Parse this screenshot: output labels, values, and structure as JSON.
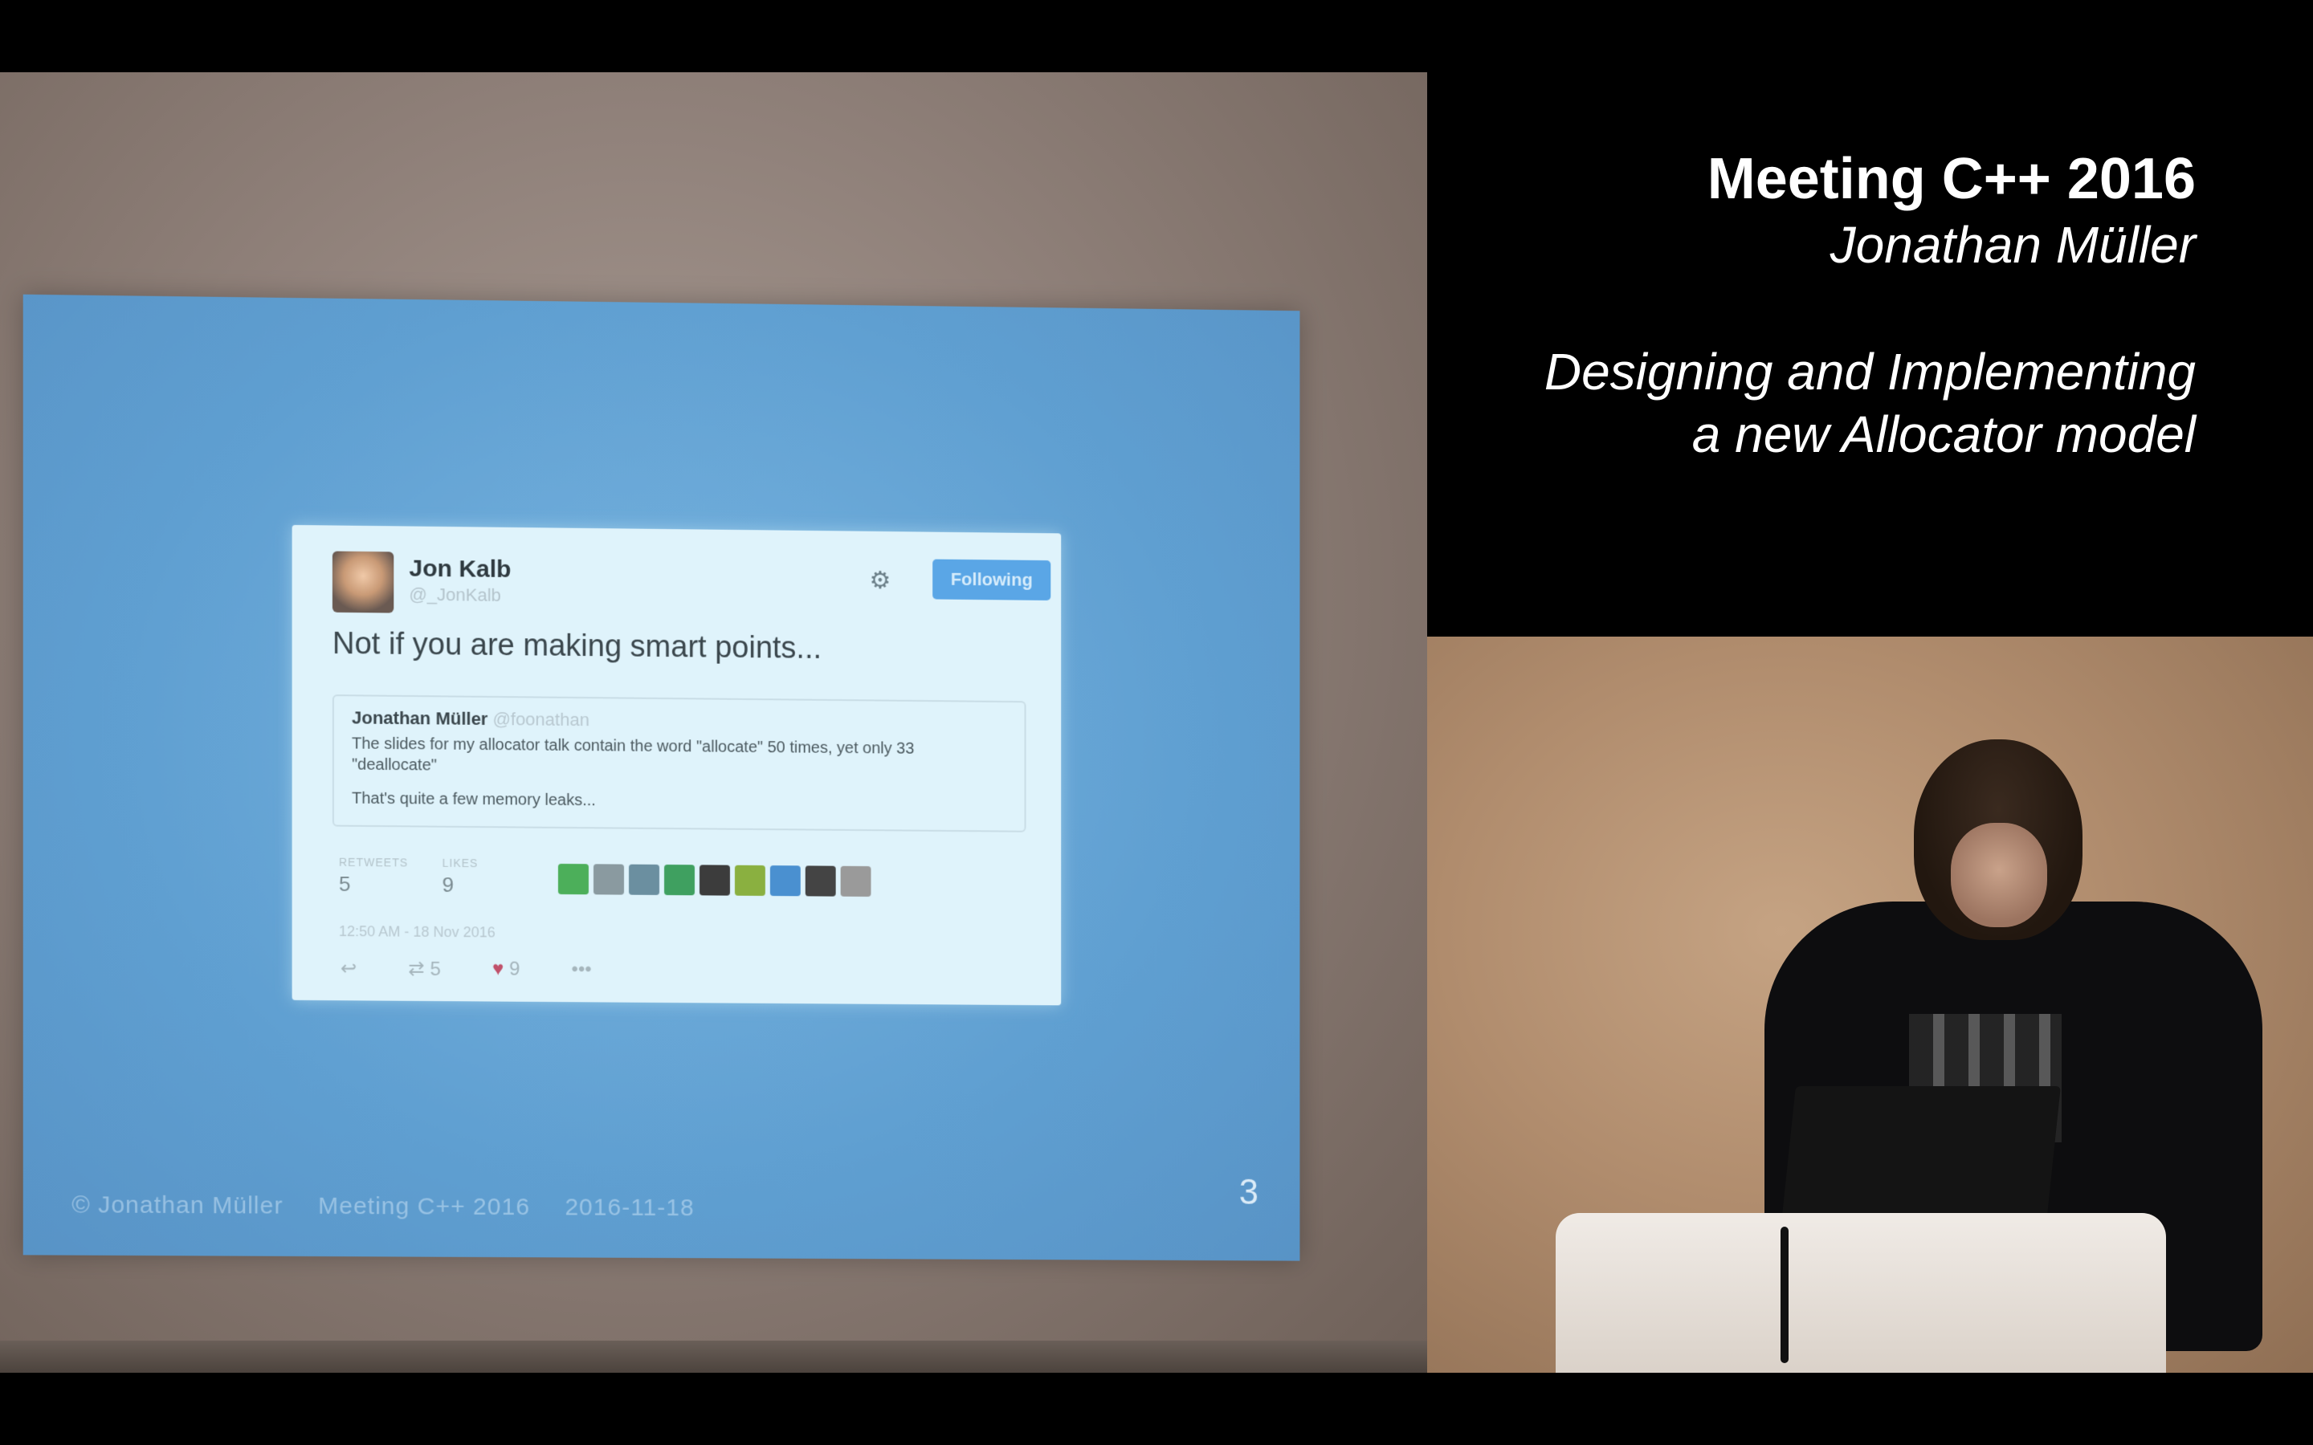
{
  "slide": {
    "tweet": {
      "author_name": "Jon Kalb",
      "author_handle": "@_JonKalb",
      "follow_label": "Following",
      "text": "Not if you are making smart points...",
      "quote": {
        "author_name": "Jonathan Müller",
        "author_handle": "@foonathan",
        "body": "The slides for my allocator talk contain the word \"allocate\" 50 times, yet only 33 \"deallocate\"",
        "extra": "That's quite a few memory leaks..."
      },
      "retweets_label": "RETWEETS",
      "retweets": "5",
      "likes_label": "LIKES",
      "likes": "9",
      "timestamp": "12:50 AM - 18 Nov 2016",
      "action_retweets": "5",
      "action_likes": "9",
      "liker_colors": [
        "#4caf5a",
        "#8a9aa0",
        "#6b8fa0",
        "#3fa060",
        "#3c3c3c",
        "#8ab040",
        "#4a90d0",
        "#444444",
        "#9a9a9a"
      ]
    },
    "footer": {
      "author": "© Jonathan Müller",
      "event": "Meeting C++ 2016",
      "date": "2016-11-18"
    },
    "page_number": "3"
  },
  "title_panel": {
    "event": "Meeting C++ 2016",
    "speaker": "Jonathan Müller",
    "talk_line_1": "Designing and Implementing",
    "talk_line_2": "a new Allocator model"
  }
}
